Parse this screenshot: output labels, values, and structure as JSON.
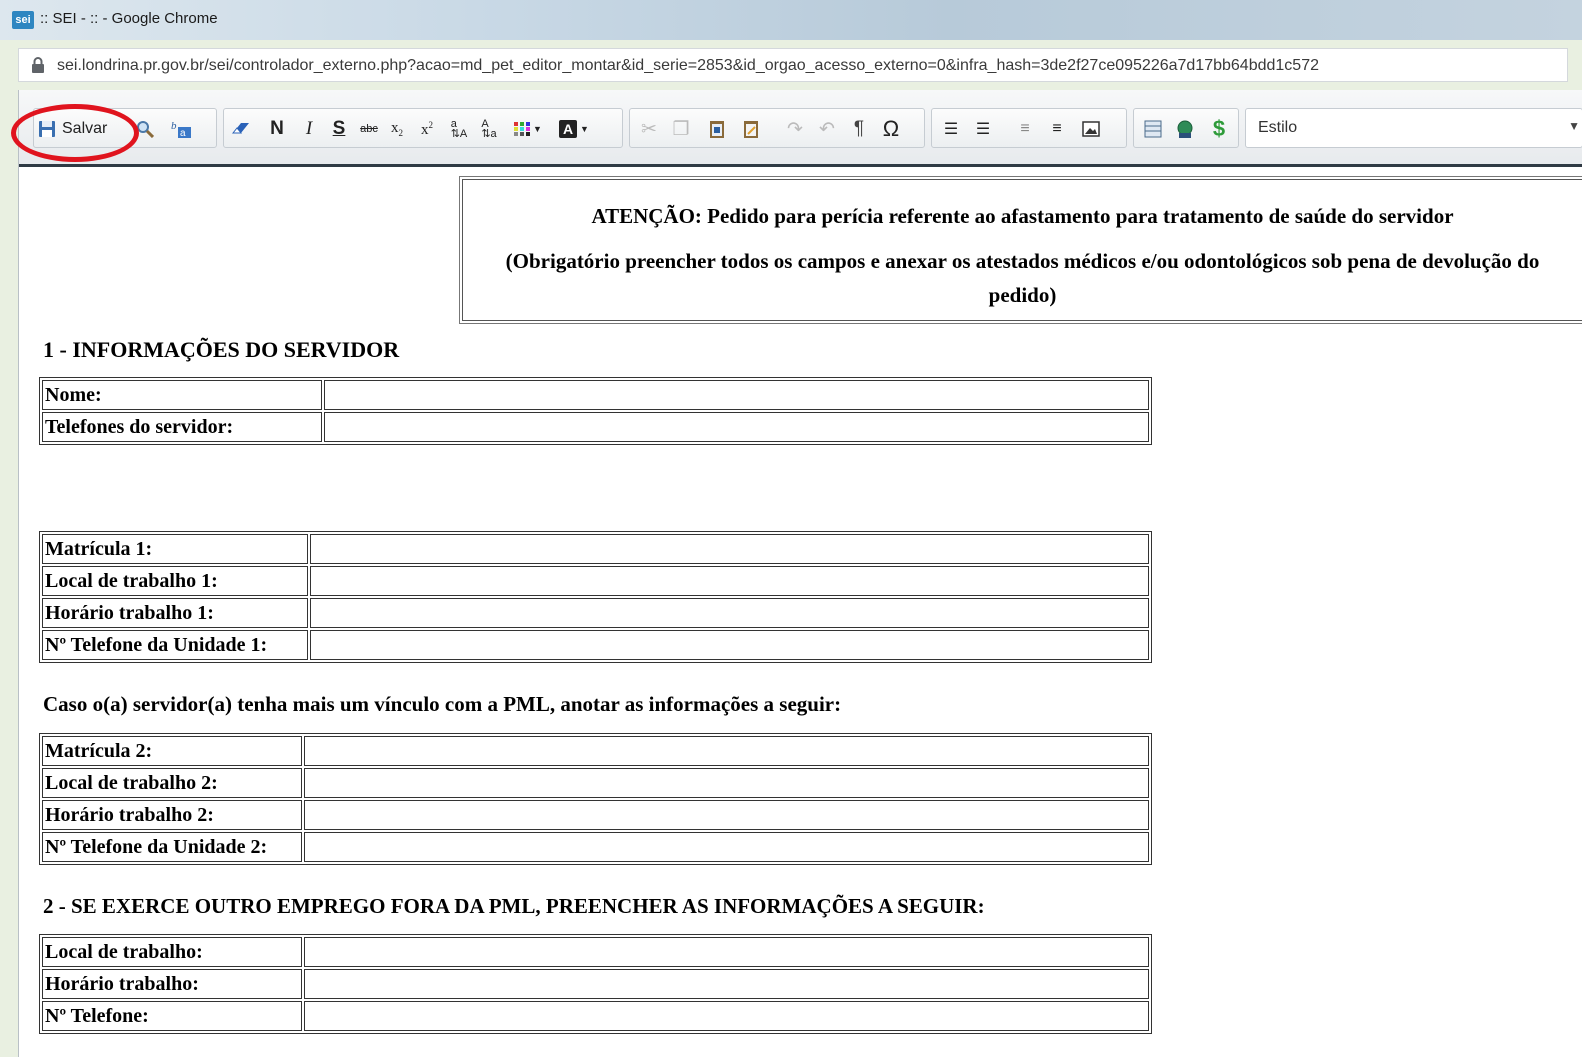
{
  "window": {
    "title": ":: SEI - :: - Google Chrome",
    "favicon_text": "sei"
  },
  "addressbar": {
    "url": "sei.londrina.pr.gov.br/sei/controlador_externo.php?acao=md_pet_editor_montar&id_serie=2853&id_orgao_acesso_externo=0&infra_hash=3de2f27ce095226a7d17bb64bdd1c572"
  },
  "toolbar": {
    "save_label": "Salvar",
    "bold_label": "N",
    "italic_label": "I",
    "underline_label": "S",
    "strike_label": "abc",
    "style_label": "Estilo",
    "highlight_color": "#e0141e"
  },
  "notice": {
    "line1": "ATENÇÃO: Pedido para perícia referente ao afastamento para tratamento de saúde do servidor",
    "line2": "(Obrigatório preencher todos os campos e anexar os atestados médicos e/ou odontológicos sob pena de devolução do pedido)"
  },
  "section1": {
    "title": "1 - INFORMAÇÕES DO SERVIDOR",
    "rows": [
      {
        "label": "Nome:",
        "value": ""
      },
      {
        "label": "Telefones do servidor:",
        "value": ""
      }
    ]
  },
  "vinculo1": {
    "rows": [
      {
        "label": "Matrícula 1:",
        "value": ""
      },
      {
        "label": "Local de trabalho 1:",
        "value": ""
      },
      {
        "label": "Horário trabalho 1:",
        "value": ""
      },
      {
        "label": "Nº Telefone da Unidade 1:",
        "value": ""
      }
    ]
  },
  "vinculo2": {
    "note": "Caso o(a) servidor(a) tenha mais um vínculo com a PML, anotar as informações a seguir:",
    "rows": [
      {
        "label": "Matrícula 2:",
        "value": ""
      },
      {
        "label": "Local de trabalho 2:",
        "value": ""
      },
      {
        "label": "Horário trabalho 2:",
        "value": ""
      },
      {
        "label": "Nº Telefone da Unidade 2:",
        "value": ""
      }
    ]
  },
  "section2": {
    "title": "2 - SE EXERCE OUTRO EMPREGO FORA DA PML, PREENCHER AS INFORMAÇÕES A SEGUIR:",
    "rows": [
      {
        "label": "Local de trabalho:",
        "value": ""
      },
      {
        "label": "Horário trabalho:",
        "value": ""
      },
      {
        "label": "Nº Telefone:",
        "value": ""
      }
    ]
  }
}
